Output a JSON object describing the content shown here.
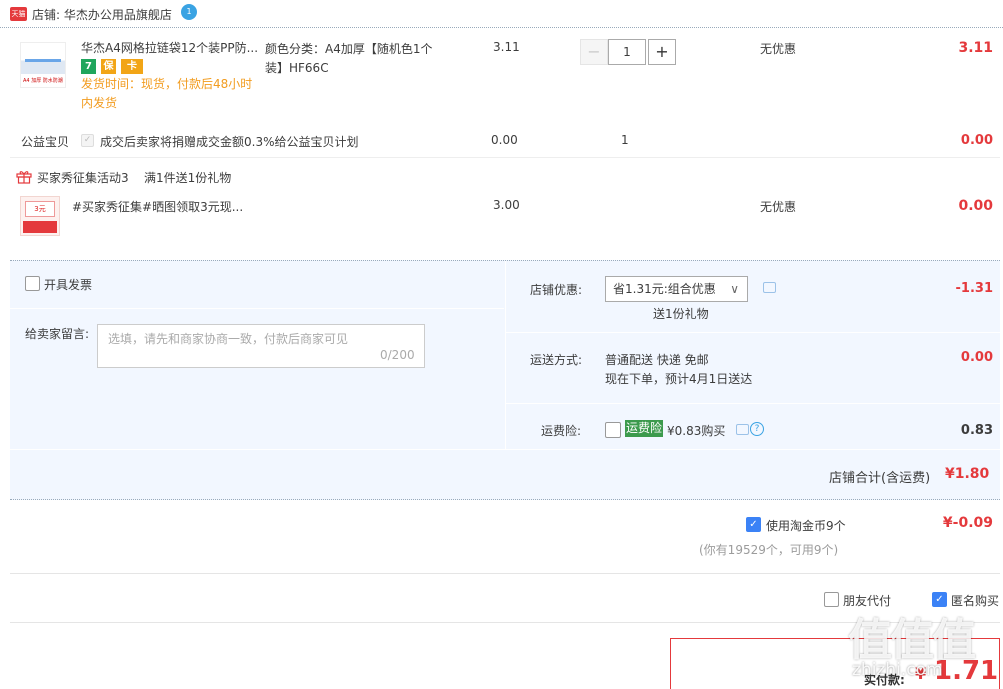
{
  "store": {
    "badge": "天猫",
    "label": "店铺: 华杰办公用品旗舰店",
    "wangwang": "1"
  },
  "item": {
    "title": "华杰A4网格拉链袋12个装PP防...",
    "thumb_caption": "A4 加厚 防水防潮",
    "tags": [
      "7",
      "保",
      "卡"
    ],
    "ship_time": "发货时间：现货，付款后48小时内发货",
    "sku": "颜色分类：A4加厚【随机色1个装】HF66C",
    "unit_price": "3.11",
    "quantity": "1",
    "minus": "−",
    "plus": "+",
    "discount": "无优惠",
    "subtotal": "3.11"
  },
  "charity": {
    "label": "公益宝贝",
    "check": "✓",
    "text": "成交后卖家将捐赠成交金额0.3%给公益宝贝计划",
    "price": "0.00",
    "qty": "1",
    "subtotal": "0.00"
  },
  "gift": {
    "activity": "买家秀征集活动3",
    "rule": "满1件送1份礼物",
    "thumb_text": "3元",
    "name": "#买家秀征集#晒图领取3元现...",
    "price": "3.00",
    "discount": "无优惠",
    "subtotal": "0.00"
  },
  "invoice": {
    "label": "开具发票"
  },
  "message": {
    "label": "给卖家留言:",
    "placeholder": "选填，请先和商家协商一致，付款后商家可见",
    "count": "0/200"
  },
  "shop_discount": {
    "label": "店铺优惠:",
    "selected": "省1.31元:组合优惠",
    "chevron": "∨",
    "gift_note": "送1份礼物",
    "value": "-1.31"
  },
  "shipping": {
    "label": "运送方式:",
    "line1": "普通配送 快递 免邮",
    "line2": "现在下单，预计4月1日送达",
    "value": "0.00"
  },
  "insurance": {
    "label": "运费险:",
    "tag": "运费险",
    "price": "¥0.83购买",
    "help": "?",
    "value": "0.83"
  },
  "store_total": {
    "label": "店铺合计(含运费)",
    "value": "¥1.80"
  },
  "coins": {
    "check": "✓",
    "label": "使用淘金币9个",
    "value": "¥-0.09",
    "note": "(你有19529个，可用9个)"
  },
  "options": {
    "friend_pay": "朋友代付",
    "anonymous": "匿名购买",
    "anon_check": "✓"
  },
  "payment": {
    "label": "实付款:",
    "currency": "¥",
    "value": "1.71"
  },
  "watermark": {
    "logo": "值值值",
    "site": "zhizhi.com"
  },
  "colors": {
    "price_red": "#e4393c",
    "panel_blue": "#f2f7ff",
    "check_blue": "#3b82f6",
    "insurance_green": "#3c9a4d"
  }
}
